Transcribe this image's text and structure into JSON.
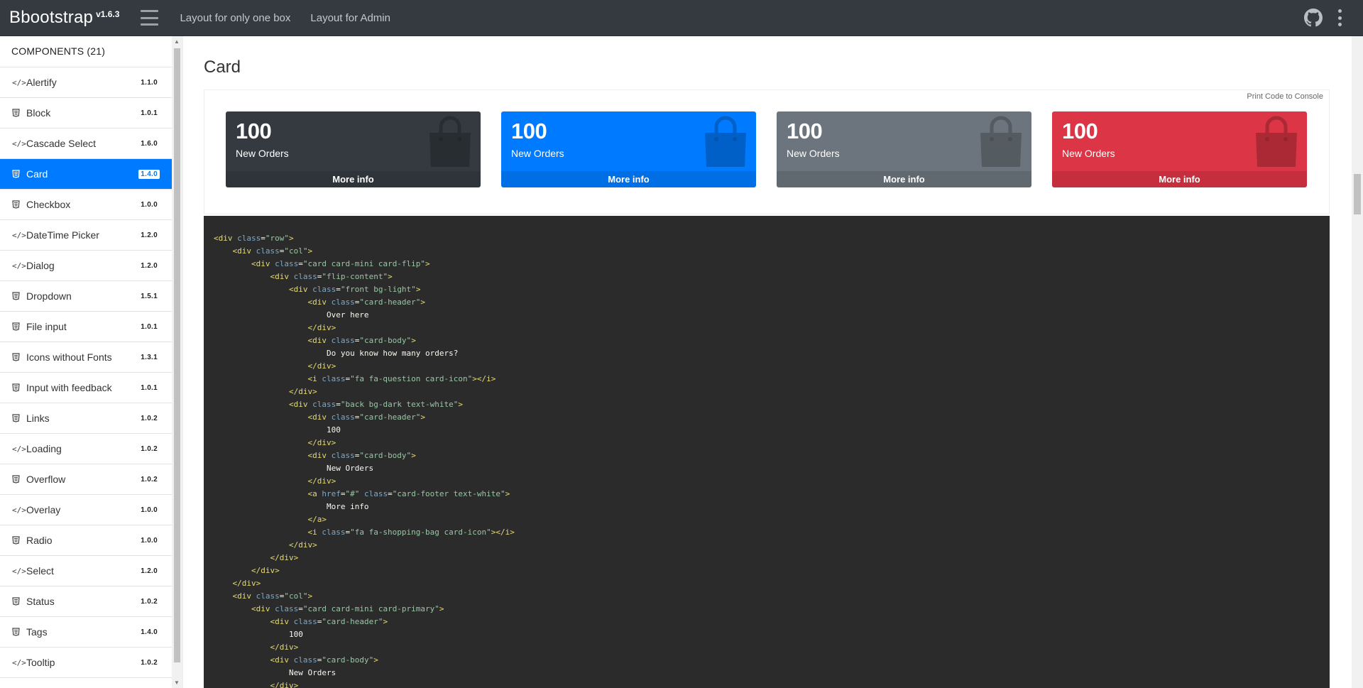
{
  "navbar": {
    "brand": "Bbootstrap",
    "version": "v1.6.3",
    "links": [
      "Layout for only one box",
      "Layout for Admin"
    ],
    "github_icon": "github-icon",
    "menu_icon": "kebab-menu-icon"
  },
  "sidebar": {
    "header": "COMPONENTS (21)",
    "items": [
      {
        "label": "Alertify",
        "version": "1.1.0",
        "icon": "code"
      },
      {
        "label": "Block",
        "version": "1.0.1",
        "icon": "css3"
      },
      {
        "label": "Cascade Select",
        "version": "1.6.0",
        "icon": "code"
      },
      {
        "label": "Card",
        "version": "1.4.0",
        "icon": "css3",
        "active": true
      },
      {
        "label": "Checkbox",
        "version": "1.0.0",
        "icon": "css3"
      },
      {
        "label": "DateTime Picker",
        "version": "1.2.0",
        "icon": "code"
      },
      {
        "label": "Dialog",
        "version": "1.2.0",
        "icon": "code"
      },
      {
        "label": "Dropdown",
        "version": "1.5.1",
        "icon": "css3"
      },
      {
        "label": "File input",
        "version": "1.0.1",
        "icon": "css3"
      },
      {
        "label": "Icons without Fonts",
        "version": "1.3.1",
        "icon": "css3"
      },
      {
        "label": "Input with feedback",
        "version": "1.0.1",
        "icon": "css3"
      },
      {
        "label": "Links",
        "version": "1.0.2",
        "icon": "css3"
      },
      {
        "label": "Loading",
        "version": "1.0.2",
        "icon": "code"
      },
      {
        "label": "Overflow",
        "version": "1.0.2",
        "icon": "css3"
      },
      {
        "label": "Overlay",
        "version": "1.0.0",
        "icon": "code"
      },
      {
        "label": "Radio",
        "version": "1.0.0",
        "icon": "css3"
      },
      {
        "label": "Select",
        "version": "1.2.0",
        "icon": "code"
      },
      {
        "label": "Status",
        "version": "1.0.2",
        "icon": "css3"
      },
      {
        "label": "Tags",
        "version": "1.4.0",
        "icon": "css3"
      },
      {
        "label": "Tooltip",
        "version": "1.0.2",
        "icon": "code"
      }
    ]
  },
  "main": {
    "title": "Card",
    "print_button": "Print Code to Console",
    "cards": [
      {
        "value": "100",
        "label": "New Orders",
        "footer": "More info",
        "color": "#343a40"
      },
      {
        "value": "100",
        "label": "New Orders",
        "footer": "More info",
        "color": "#007bff"
      },
      {
        "value": "100",
        "label": "New Orders",
        "footer": "More info",
        "color": "#6c757d"
      },
      {
        "value": "100",
        "label": "New Orders",
        "footer": "More info",
        "color": "#dc3545"
      }
    ],
    "code_lines": [
      "<div class=\"row\">",
      "    <div class=\"col\">",
      "        <div class=\"card card-mini card-flip\">",
      "            <div class=\"flip-content\">",
      "                <div class=\"front bg-light\">",
      "                    <div class=\"card-header\">",
      "                        Over here",
      "                    </div>",
      "                    <div class=\"card-body\">",
      "                        Do you know how many orders?",
      "                    </div>",
      "                    <i class=\"fa fa-question card-icon\"></i>",
      "                </div>",
      "                <div class=\"back bg-dark text-white\">",
      "                    <div class=\"card-header\">",
      "                        100",
      "                    </div>",
      "                    <div class=\"card-body\">",
      "                        New Orders",
      "                    </div>",
      "                    <a href=\"#\" class=\"card-footer text-white\">",
      "                        More info",
      "                    </a>",
      "                    <i class=\"fa fa-shopping-bag card-icon\"></i>",
      "                </div>",
      "            </div>",
      "        </div>",
      "    </div>",
      "    <div class=\"col\">",
      "        <div class=\"card card-mini card-primary\">",
      "            <div class=\"card-header\">",
      "                100",
      "            </div>",
      "            <div class=\"card-body\">",
      "                New Orders",
      "            </div>"
    ]
  }
}
